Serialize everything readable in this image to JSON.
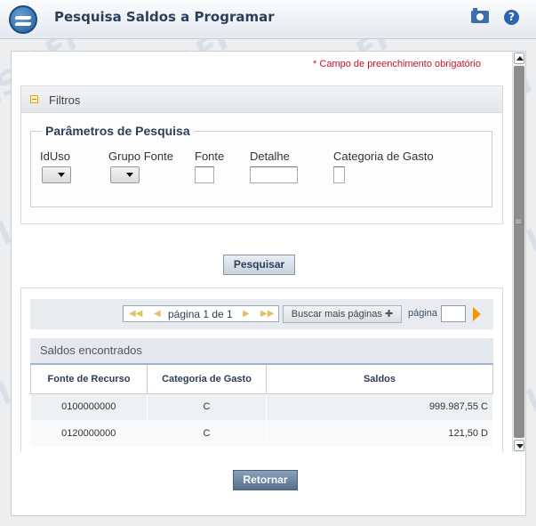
{
  "header": {
    "title": "Pesquisa Saldos a Programar",
    "camera_icon": "camera-icon",
    "help_icon": "help-icon",
    "help_symbol": "?"
  },
  "form": {
    "required_note": "* Campo de preenchimento obrigatório",
    "filters_title": "Filtros",
    "params_legend": "Parâmetros de Pesquisa",
    "fields": {
      "iduso": "IdUso",
      "grupo_fonte": "Grupo Fonte",
      "fonte": "Fonte",
      "detalhe": "Detalhe",
      "categoria_gasto": "Categoria de Gasto"
    },
    "search_button": "Pesquisar"
  },
  "pager": {
    "page_text": "página 1 de 1",
    "more_button": "Buscar mais páginas",
    "page_label": "página"
  },
  "results": {
    "title": "Saldos encontrados",
    "columns": [
      "Fonte de Recurso",
      "Categoria de Gasto",
      "Saldos"
    ],
    "rows": [
      [
        "0100000000",
        "C",
        "999.987,55 C"
      ],
      [
        "0120000000",
        "C",
        "121,50 D"
      ]
    ]
  },
  "footer": {
    "return_button": "Retornar"
  },
  "colors": {
    "accent": "#2b66b0",
    "required": "#c8102e",
    "go_arrow": "#ee9b00"
  }
}
